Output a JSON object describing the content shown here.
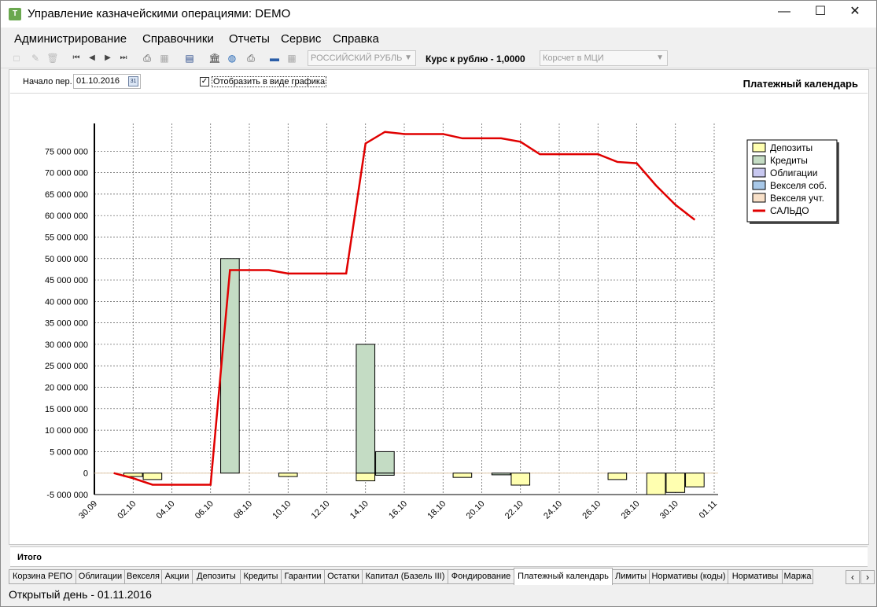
{
  "window": {
    "title": "Управление казначейскими операциями: DEMO",
    "icon_letter": "T",
    "minimize": "—",
    "maximize": "☐",
    "close": "✕"
  },
  "menu": [
    "Администрирование",
    "Справочники",
    "Отчеты",
    "Сервис",
    "Справка"
  ],
  "toolbar": {
    "currency_select": "РОССИЙСКИЙ РУБЛЬ",
    "rate_label": "Курс к рублю -  1,0000",
    "account_select": "Корсчет в МЦИ"
  },
  "filter": {
    "start_label": "Начало пер.",
    "start_date": "01.10.2016",
    "calendar_icon_text": "31",
    "show_chart_label": "Отобразить в виде графика",
    "show_chart_checked": true,
    "panel_title": "Платежный календарь"
  },
  "total_label": "Итого",
  "tabs": [
    "Корзина РЕПО",
    "Облигации",
    "Векселя",
    "Акции",
    "Депозиты",
    "Кредиты",
    "Гарантии",
    "Остатки",
    "Капитал (Базель III)",
    "Фондирование",
    "Платежный календарь",
    "Лимиты",
    "Нормативы (коды)",
    "Нормативы",
    "Маржа"
  ],
  "active_tab": "Платежный календарь",
  "status": "Открытый день - 01.11.2016",
  "colors": {
    "deposits": "#ffffb0",
    "credits": "#c4dcc4",
    "bonds": "#c8c8f0",
    "own_bills": "#a8c8e8",
    "discounted_bills": "#f8e0c8",
    "saldo": "#e00000"
  },
  "chart_data": {
    "type": "bar",
    "title": "",
    "xlabel": "",
    "ylabel": "",
    "ylim": [
      -5000000,
      80000000
    ],
    "y_ticks": [
      -5000000,
      0,
      5000000,
      10000000,
      15000000,
      20000000,
      25000000,
      30000000,
      35000000,
      40000000,
      45000000,
      50000000,
      55000000,
      60000000,
      65000000,
      70000000,
      75000000
    ],
    "y_tick_labels": [
      "-5 000 000",
      "0",
      "5 000 000",
      "10 000 000",
      "15 000 000",
      "20 000 000",
      "25 000 000",
      "30 000 000",
      "35 000 000",
      "40 000 000",
      "45 000 000",
      "50 000 000",
      "55 000 000",
      "60 000 000",
      "65 000 000",
      "70 000 000",
      "75 000 000"
    ],
    "x_ticks": [
      "30.09",
      "02.10",
      "04.10",
      "06.10",
      "08.10",
      "10.10",
      "12.10",
      "14.10",
      "16.10",
      "18.10",
      "20.10",
      "22.10",
      "24.10",
      "26.10",
      "28.10",
      "30.10",
      "01.11"
    ],
    "grid": true,
    "legend_position": "top-right",
    "legend": [
      "Депозиты",
      "Кредиты",
      "Облигации",
      "Векселя соб.",
      "Векселя учт.",
      "САЛЬДО"
    ],
    "series": [
      {
        "name": "Депозиты",
        "type": "bar",
        "points": [
          {
            "date": "02.10",
            "value": -800000
          },
          {
            "date": "03.10",
            "value": -1500000
          },
          {
            "date": "10.10",
            "value": -800000
          },
          {
            "date": "14.10",
            "value": -1800000
          },
          {
            "date": "19.10",
            "value": -1000000
          },
          {
            "date": "22.10",
            "value": -2800000
          },
          {
            "date": "27.10",
            "value": -1500000
          },
          {
            "date": "29.10",
            "value": -5000000
          },
          {
            "date": "30.10",
            "value": -4500000
          },
          {
            "date": "31.10",
            "value": -3200000
          }
        ]
      },
      {
        "name": "Кредиты",
        "type": "bar",
        "points": [
          {
            "date": "07.10",
            "value": 50000000
          },
          {
            "date": "14.10",
            "value": 30000000
          },
          {
            "date": "15.10",
            "value": 5000000
          }
        ]
      },
      {
        "name": "Кредиты",
        "type": "bar_neg",
        "points": [
          {
            "date": "15.10",
            "value": -500000
          },
          {
            "date": "21.10",
            "value": -400000
          }
        ]
      },
      {
        "name": "САЛЬДО",
        "type": "line",
        "points": [
          {
            "date": "01.10",
            "value": 0
          },
          {
            "date": "02.10",
            "value": -1200000
          },
          {
            "date": "03.10",
            "value": -2700000
          },
          {
            "date": "05.10",
            "value": -2700000
          },
          {
            "date": "06.10",
            "value": -2700000
          },
          {
            "date": "07.10",
            "value": 47300000
          },
          {
            "date": "09.10",
            "value": 47300000
          },
          {
            "date": "10.10",
            "value": 46500000
          },
          {
            "date": "13.10",
            "value": 46500000
          },
          {
            "date": "14.10",
            "value": 76800000
          },
          {
            "date": "15.10",
            "value": 79500000
          },
          {
            "date": "16.10",
            "value": 79000000
          },
          {
            "date": "18.10",
            "value": 79000000
          },
          {
            "date": "19.10",
            "value": 78000000
          },
          {
            "date": "21.10",
            "value": 78000000
          },
          {
            "date": "22.10",
            "value": 77200000
          },
          {
            "date": "23.10",
            "value": 74300000
          },
          {
            "date": "26.10",
            "value": 74300000
          },
          {
            "date": "27.10",
            "value": 72500000
          },
          {
            "date": "28.10",
            "value": 72200000
          },
          {
            "date": "29.10",
            "value": 67000000
          },
          {
            "date": "30.10",
            "value": 62500000
          },
          {
            "date": "31.10",
            "value": 59000000
          }
        ]
      }
    ]
  }
}
